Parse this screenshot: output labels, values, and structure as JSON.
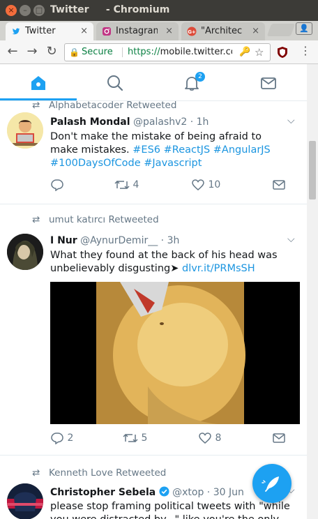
{
  "window": {
    "title": "Twitter     - Chromium"
  },
  "tabs": [
    {
      "label": "Twitter",
      "active": true
    },
    {
      "label": "Instagram",
      "active": false
    },
    {
      "label": "\"Architec",
      "active": false
    }
  ],
  "omnibox": {
    "secure_label": "Secure",
    "scheme": "https://",
    "host": "mobile.twitter.co"
  },
  "nav": {
    "notifications_count": "2"
  },
  "tweets": [
    {
      "retweeted_by": "Alphabetacoder Retweeted",
      "name": "Palash Mondal",
      "handle": "@palashv2",
      "time": "· 1h",
      "text_plain": "Don't make the mistake of being afraid to make mistakes. ",
      "hashtags_line1": "#ES6 #ReactJS #AngularJS",
      "hashtags_line2": "#100DaysOfCode #Javascript",
      "replies": "",
      "retweets": "4",
      "likes": "10"
    },
    {
      "retweeted_by": "umut katırcı Retweeted",
      "name": "I Nur",
      "handle": "@AynurDemir__",
      "time": "· 3h",
      "text_plain": "What they found at the back of his head was unbelievably disgusting➤ ",
      "link": "dlvr.it/PRMsSH",
      "replies": "2",
      "retweets": "5",
      "likes": "8"
    },
    {
      "retweeted_by": "Kenneth Love Retweeted",
      "name": "Christopher Sebela",
      "handle": "@xtop",
      "time": "· 30 Jun",
      "text_plain": "please stop framing political tweets with \"while you were distracted by...\" like you're the only person"
    }
  ],
  "colors": {
    "accent": "#1da1f2",
    "link": "#1b95e0",
    "secure": "#0b8043"
  }
}
